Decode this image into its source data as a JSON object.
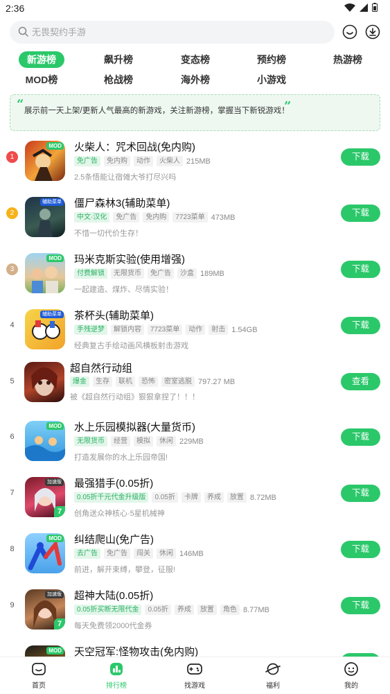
{
  "status": {
    "time": "2:36"
  },
  "search": {
    "placeholder": "无畏契约手游"
  },
  "tabs": [
    {
      "label": "新游榜",
      "active": true
    },
    {
      "label": "飙升榜"
    },
    {
      "label": "变态榜"
    },
    {
      "label": "预约榜"
    },
    {
      "label": "热游榜"
    },
    {
      "label": "MOD榜"
    },
    {
      "label": "枪战榜"
    },
    {
      "label": "海外榜"
    },
    {
      "label": "小游戏"
    }
  ],
  "banner": {
    "open_quote": "“",
    "text": "展示前一天上架/更新人气最高的新游戏，关注新游榜，掌握当下新锐游戏！",
    "close_quote": "”"
  },
  "colors": {
    "accent": "#2bc86a",
    "rank1": "#f04b4b",
    "rank2": "#f7b21a",
    "rank3": "#d3b08b"
  },
  "apps": [
    {
      "rank": "1",
      "name": "火柴人：咒术回战(免内购)",
      "badge": "MOD",
      "tags": [
        "免广告",
        "免内购",
        "动作",
        "火柴人"
      ],
      "size": "215MB",
      "desc": "2.5条悟能让宿傩大爷打尽兴吗",
      "button": "下载"
    },
    {
      "rank": "2",
      "name": "僵尸森林3(辅助菜单)",
      "badge": "辅助菜单",
      "tags": [
        "中文·汉化",
        "免广告",
        "免内购",
        "7723菜单"
      ],
      "size": "473MB",
      "desc": "不惜一切代价生存！",
      "button": "下载"
    },
    {
      "rank": "3",
      "name": "玛米克斯实验(使用增强)",
      "badge": "MOD",
      "tags": [
        "付费解锁",
        "无限货币",
        "免广告",
        "沙盒"
      ],
      "size": "189MB",
      "desc": "一起建造、煤炸、尽情实验！",
      "button": "下载"
    },
    {
      "rank": "4",
      "name": "茶杯头(辅助菜单)",
      "badge": "辅助菜单",
      "tags": [
        "手残逆梦",
        "解锁内容",
        "7723菜单",
        "动作",
        "射击"
      ],
      "size": "1.54GB",
      "desc": "经典复古手绘动画风横板射击游戏",
      "button": "下载"
    },
    {
      "rank": "5",
      "name": "超自然行动组",
      "badge": "",
      "tags": [
        "爆金",
        "生存",
        "联机",
        "恐怖",
        "密室逃脱"
      ],
      "size": "797.27 MB",
      "desc": "被《超自然行动组》狠狠拿捏了！！！",
      "button": "查看"
    },
    {
      "rank": "6",
      "name": "水上乐园模拟器(大量货币)",
      "badge": "MOD",
      "tags": [
        "无限货币",
        "经营",
        "模拟",
        "休闲"
      ],
      "size": "229MB",
      "desc": "打造发展你的水上乐园帝国!",
      "button": "下载"
    },
    {
      "rank": "7",
      "name": "最强猎手(0.05折)",
      "badge": "加速版",
      "tags": [
        "0.05折千元代金升级版",
        "0.05折",
        "卡牌",
        "养成",
        "放置"
      ],
      "size": "8.72MB",
      "desc": "创角送众神核心·5星机械神",
      "button": "下载"
    },
    {
      "rank": "8",
      "name": "纠结爬山(免广告)",
      "badge": "MOD",
      "tags": [
        "去广告",
        "免广告",
        "闯关",
        "休闲"
      ],
      "size": "146MB",
      "desc": "前进，解开束缚，攀登，征服!",
      "button": "下载"
    },
    {
      "rank": "9",
      "name": "超神大陆(0.05折)",
      "badge": "加速版",
      "tags": [
        "0.05折买断无限代金",
        "0.05折",
        "养成",
        "放置",
        "角色"
      ],
      "size": "8.77MB",
      "desc": "每天免费领2000代金券",
      "button": "下载"
    },
    {
      "rank": "10",
      "name": "天空冠军:怪物攻击(免内购)",
      "badge": "MOD",
      "tags": [],
      "size": "",
      "desc": "",
      "button": "下载"
    }
  ],
  "bottom_nav": [
    {
      "label": "首页",
      "icon": "home-icon"
    },
    {
      "label": "排行榜",
      "icon": "ranking-icon",
      "active": true
    },
    {
      "label": "找游戏",
      "icon": "gamepad-icon"
    },
    {
      "label": "福利",
      "icon": "planet-icon"
    },
    {
      "label": "我的",
      "icon": "profile-icon"
    }
  ]
}
